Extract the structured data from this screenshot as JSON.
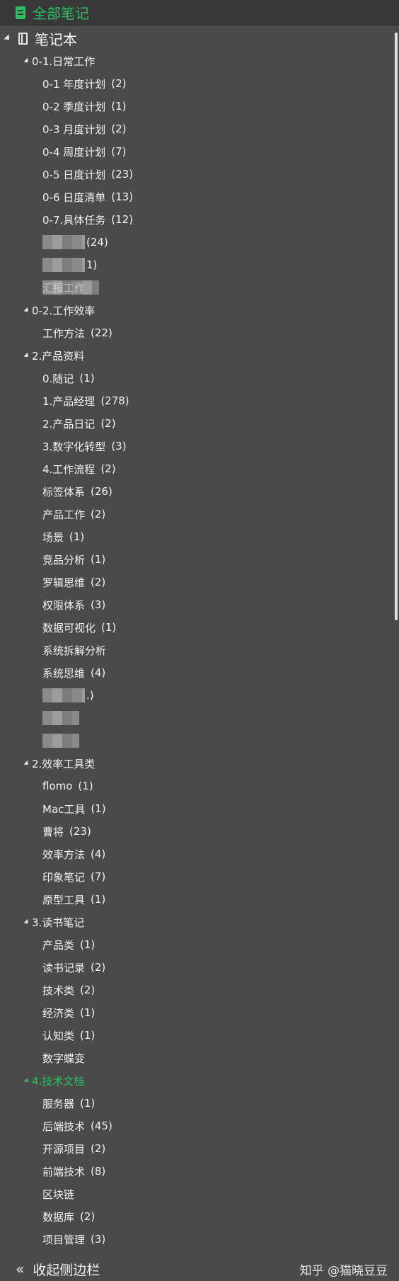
{
  "header": {
    "title": "全部笔记",
    "icon": "note-icon"
  },
  "root": {
    "label": "笔记本",
    "icon": "notebook-icon"
  },
  "groups": [
    {
      "label": "0-1.日常工作",
      "items": [
        {
          "name": "0-1 年度计划",
          "count": "(2)"
        },
        {
          "name": "0-2 季度计划",
          "count": "(1)"
        },
        {
          "name": "0-3 月度计划",
          "count": "(2)"
        },
        {
          "name": "0-4 周度计划",
          "count": "(7)"
        },
        {
          "name": "0-5 日度计划",
          "count": "(23)"
        },
        {
          "name": "0-6 日度清单",
          "count": "(13)"
        },
        {
          "name": "0-7.具体任务",
          "count": "(12)"
        },
        {
          "name": "",
          "count": "(24)",
          "blurred": true
        },
        {
          "name": "",
          "count": "1)",
          "blurred": true
        },
        {
          "name": "汇报工作",
          "count": "",
          "blurred": true
        }
      ]
    },
    {
      "label": "0-2.工作效率",
      "items": [
        {
          "name": "工作方法",
          "count": "(22)"
        }
      ]
    },
    {
      "label": "2.产品资料",
      "items": [
        {
          "name": "0.随记",
          "count": "(1)"
        },
        {
          "name": "1.产品经理",
          "count": "(278)"
        },
        {
          "name": "2.产品日记",
          "count": "(2)"
        },
        {
          "name": "3.数字化转型",
          "count": "(3)"
        },
        {
          "name": "4.工作流程",
          "count": "(2)"
        },
        {
          "name": "标签体系",
          "count": "(26)"
        },
        {
          "name": "产品工作",
          "count": "(2)"
        },
        {
          "name": "场景",
          "count": "(1)"
        },
        {
          "name": "竞品分析",
          "count": "(1)"
        },
        {
          "name": "罗辑思维",
          "count": "(2)"
        },
        {
          "name": "权限体系",
          "count": "(3)"
        },
        {
          "name": "数据可视化",
          "count": "(1)"
        },
        {
          "name": "系统拆解分析",
          "count": ""
        },
        {
          "name": "系统思维",
          "count": "(4)"
        },
        {
          "name": "",
          "count": ".)",
          "blurred": true
        },
        {
          "name": "",
          "count": "",
          "blurred": true
        },
        {
          "name": "",
          "count": "",
          "blurred": true
        }
      ]
    },
    {
      "label": "2.效率工具类",
      "items": [
        {
          "name": "flomo",
          "count": "(1)"
        },
        {
          "name": "Mac工具",
          "count": "(1)"
        },
        {
          "name": "曹将",
          "count": "(23)"
        },
        {
          "name": "效率方法",
          "count": "(4)"
        },
        {
          "name": "印象笔记",
          "count": "(7)"
        },
        {
          "name": "原型工具",
          "count": "(1)"
        }
      ]
    },
    {
      "label": "3.读书笔记",
      "items": [
        {
          "name": "产品类",
          "count": "(1)"
        },
        {
          "name": "读书记录",
          "count": "(2)"
        },
        {
          "name": "技术类",
          "count": "(2)"
        },
        {
          "name": "经济类",
          "count": "(1)"
        },
        {
          "name": "认知类",
          "count": "(1)"
        },
        {
          "name": "数字蝶变",
          "count": ""
        }
      ]
    },
    {
      "label": "4.技术文档",
      "active": true,
      "items": [
        {
          "name": "服务器",
          "count": "(1)"
        },
        {
          "name": "后端技术",
          "count": "(45)"
        },
        {
          "name": "开源项目",
          "count": "(2)"
        },
        {
          "name": "前端技术",
          "count": "(8)"
        },
        {
          "name": "区块链",
          "count": ""
        },
        {
          "name": "数据库",
          "count": "(2)"
        },
        {
          "name": "项目管理",
          "count": "(3)"
        }
      ]
    }
  ],
  "footer": {
    "collapse_icon": "«",
    "label": "收起侧边栏",
    "watermark": "知乎 @猫晓豆豆"
  },
  "colors": {
    "accent": "#2dbe60",
    "background": "#4a4a4a"
  }
}
